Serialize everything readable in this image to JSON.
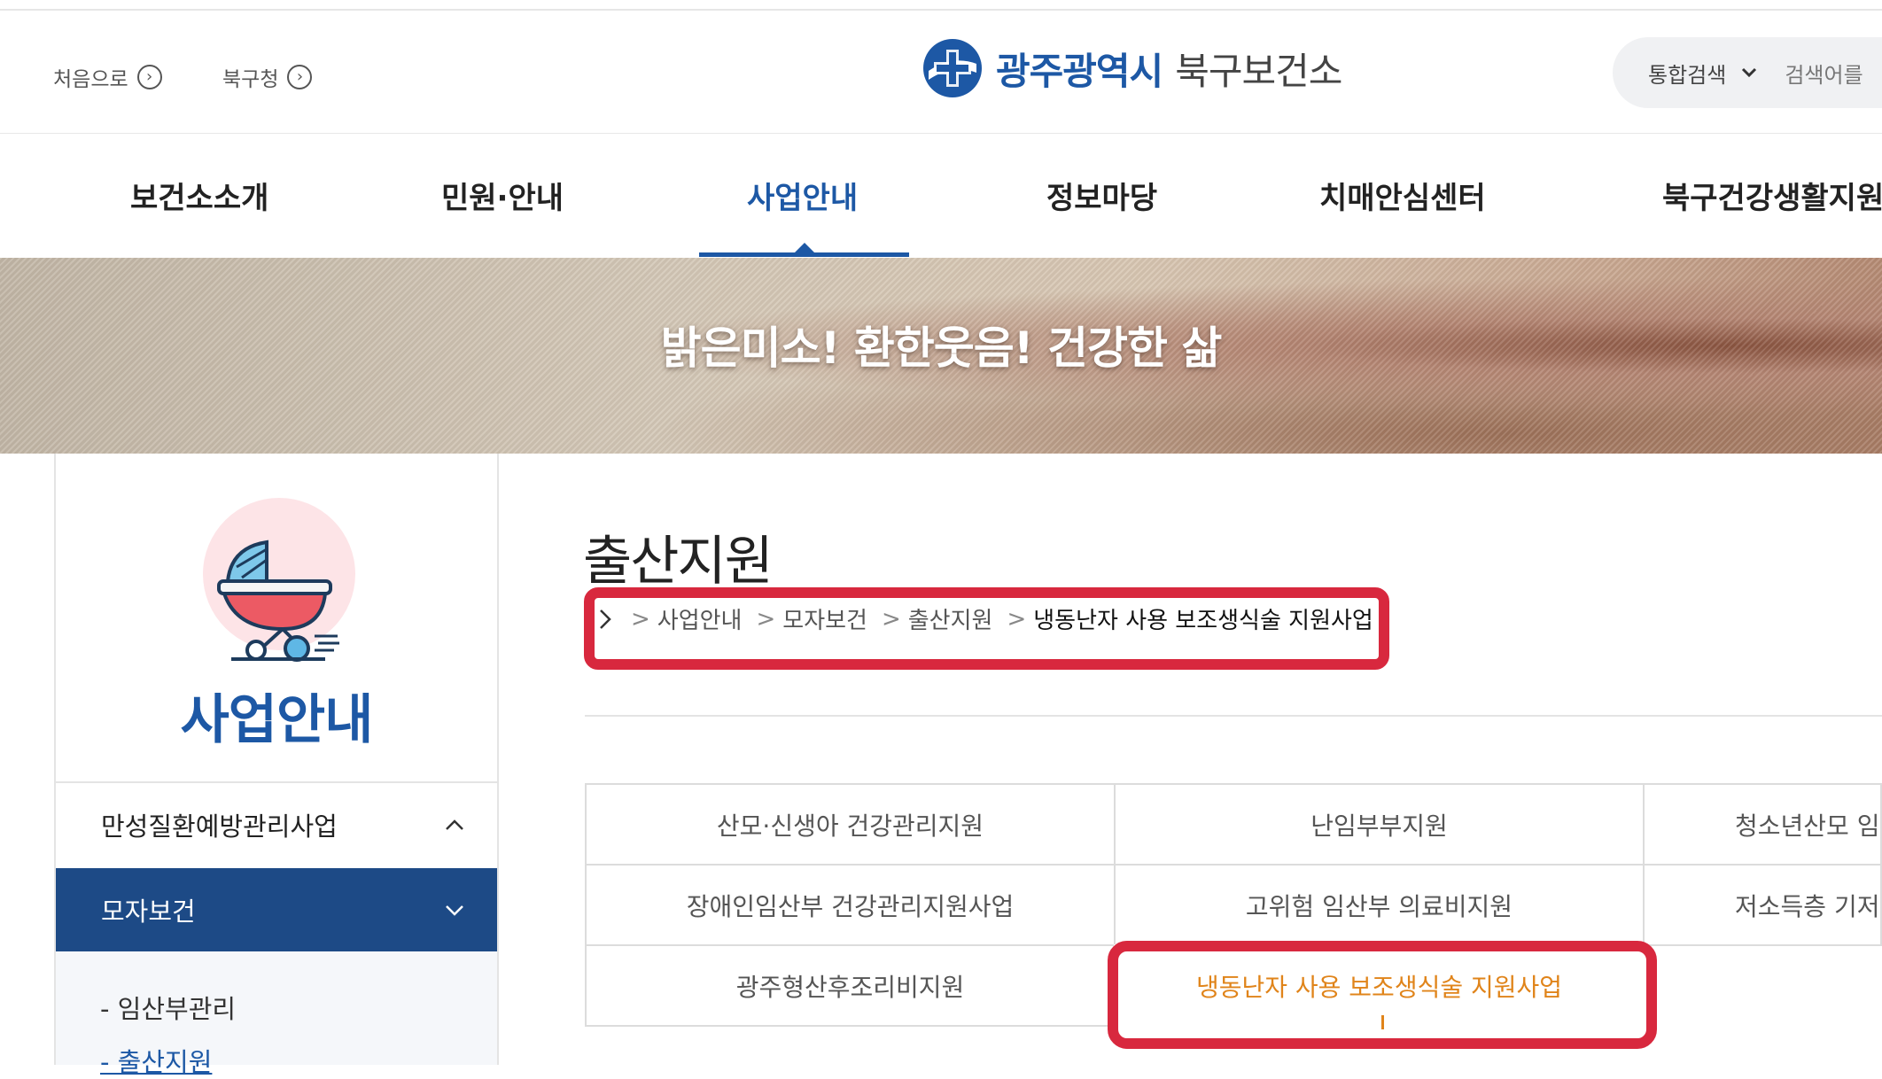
{
  "utility_links": [
    {
      "label": "처음으로"
    },
    {
      "label": "북구청"
    }
  ],
  "logo": {
    "part1": "광주광역시",
    "part2": "북구보건소"
  },
  "search": {
    "scope": "통합검색",
    "placeholder": "검색어를"
  },
  "gnb": [
    {
      "label": "보건소소개"
    },
    {
      "label": "민원·안내"
    },
    {
      "label": "사업안내",
      "active": true
    },
    {
      "label": "정보마당"
    },
    {
      "label": "치매안심센터"
    },
    {
      "label": "북구건강생활지원"
    }
  ],
  "banner": {
    "slogan": "밝은미소! 환한웃음! 건강한 삶"
  },
  "lnb": {
    "title": "사업안내",
    "menu": [
      {
        "label": "만성질환예방관리사업",
        "state": "collapsed"
      },
      {
        "label": "모자보건",
        "state": "expanded"
      }
    ],
    "submenu": [
      {
        "label": "- 임산부관리"
      },
      {
        "label": "- 출산지원",
        "active": true
      }
    ]
  },
  "content": {
    "title": "출산지원",
    "breadcrumb": [
      "사업안내",
      "모자보건",
      "출산지원",
      "냉동난자 사용 보조생식술 지원사업"
    ]
  },
  "tabs": [
    [
      {
        "label": "산모·신생아 건강관리지원"
      },
      {
        "label": "난임부부지원"
      },
      {
        "label": "청소년산모 임"
      }
    ],
    [
      {
        "label": "장애인임산부 건강관리지원사업"
      },
      {
        "label": "고위험 임산부 의료비지원"
      },
      {
        "label": "저소득층 기저"
      }
    ],
    [
      {
        "label": "광주형산후조리비지원"
      },
      {
        "label": "냉동난자 사용 보조생식술 지원사업",
        "active": true
      }
    ]
  ],
  "colors": {
    "primary": "#1d58a5",
    "nav_active_bg": "#1d4a86",
    "highlight": "#d8283e",
    "active_tab_text": "#e0841a"
  }
}
